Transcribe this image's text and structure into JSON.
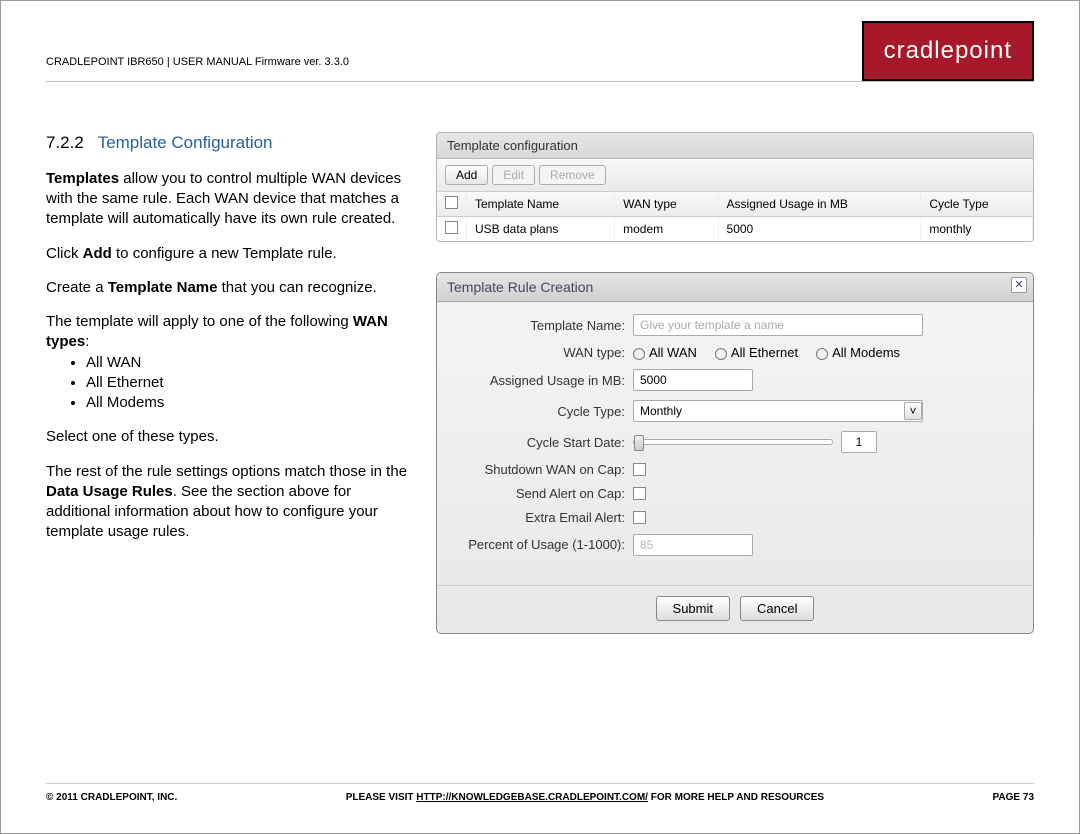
{
  "header": {
    "text": "CRADLEPOINT IBR650 | USER MANUAL Firmware ver. 3.3.0",
    "logo": "cradlepoint"
  },
  "section": {
    "number": "7.2.2",
    "title": "Template Configuration"
  },
  "body": {
    "p1a": "Templates",
    "p1b": " allow you to control multiple WAN devices with the same rule. Each WAN device that matches a template will automatically have its own rule created.",
    "p2a": "Click ",
    "p2b": "Add",
    "p2c": " to configure a new Template rule.",
    "p3a": "Create a ",
    "p3b": "Template Name",
    "p3c": " that you can recognize.",
    "p4a": "The template will apply to one of the following ",
    "p4b": "WAN types",
    "p4c": ":",
    "li1": "All WAN",
    "li2": "All Ethernet",
    "li3": "All Modems",
    "p5": "Select one of these types.",
    "p6a": "The rest of the rule settings options match those in the ",
    "p6b": "Data Usage Rules",
    "p6c": ". See the section above for additional information about how to configure your template usage rules."
  },
  "panel1": {
    "title": "Template configuration",
    "buttons": {
      "add": "Add",
      "edit": "Edit",
      "remove": "Remove"
    },
    "headers": [
      "",
      "Template Name",
      "WAN type",
      "Assigned Usage in MB",
      "Cycle Type"
    ],
    "row": [
      "",
      "USB data plans",
      "modem",
      "5000",
      "monthly"
    ]
  },
  "panel2": {
    "title": "Template Rule Creation",
    "labels": {
      "tname": "Template Name:",
      "wtype": "WAN type:",
      "usage": "Assigned Usage in MB:",
      "ctype": "Cycle Type:",
      "cstart": "Cycle Start Date:",
      "shutdown": "Shutdown WAN on Cap:",
      "alert": "Send Alert on Cap:",
      "email": "Extra Email Alert:",
      "percent": "Percent of Usage (1-1000):"
    },
    "values": {
      "tname_ph": "Give your template a name",
      "wan_opts": [
        "All WAN",
        "All Ethernet",
        "All Modems"
      ],
      "usage_val": "5000",
      "ctype_val": "Monthly",
      "cstart_val": "1",
      "percent_val": "85"
    },
    "buttons": {
      "submit": "Submit",
      "cancel": "Cancel"
    }
  },
  "footer": {
    "copyright": "© 2011 CRADLEPOINT, INC.",
    "mid_a": "PLEASE VISIT ",
    "mid_link": "HTTP://KNOWLEDGEBASE.CRADLEPOINT.COM/",
    "mid_b": " FOR MORE HELP AND RESOURCES",
    "page": "PAGE 73"
  }
}
